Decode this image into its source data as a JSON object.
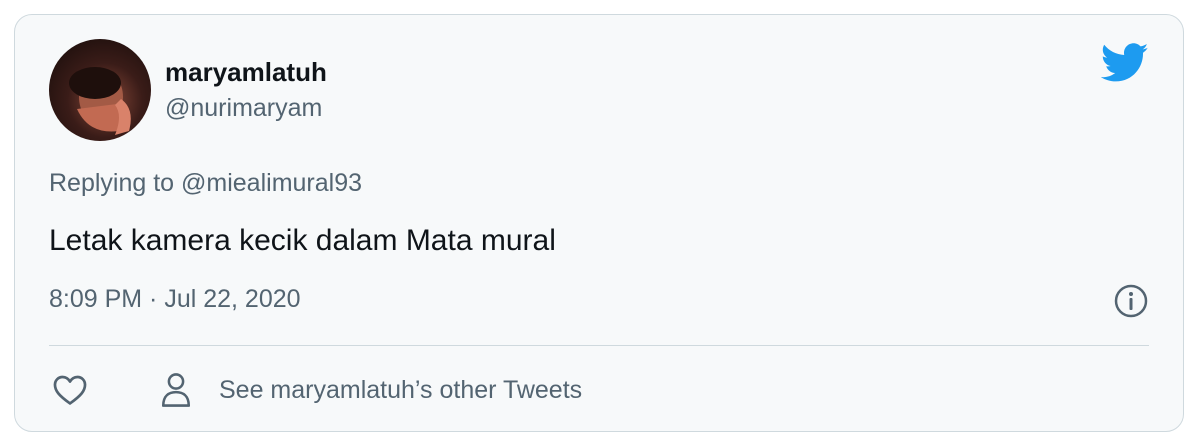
{
  "tweet": {
    "display_name": "maryamlatuh",
    "handle": "@nurimaryam",
    "replying_to": "Replying to @miealimural93",
    "text": "Letak kamera kecik dalam Mata mural",
    "timestamp": "8:09 PM · Jul 22, 2020"
  },
  "actions": {
    "like_icon": "heart-icon",
    "profile_icon": "person-icon",
    "other_tweets_label": "See maryamlatuh’s other Tweets"
  },
  "icons": {
    "brand": "twitter-bird-icon",
    "info": "info-icon"
  },
  "colors": {
    "brand_blue": "#1d9bf0",
    "secondary_text": "#536471",
    "primary_text": "#0f1419",
    "card_background": "#f7f9fa",
    "border": "#cfd9de"
  }
}
